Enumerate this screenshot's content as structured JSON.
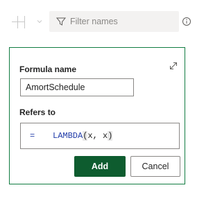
{
  "toolbar": {
    "add_icon": "add-icon",
    "chevron_icon": "chevron-down-icon",
    "filter_icon": "filter-icon",
    "filter_placeholder": "Filter names",
    "info_icon": "info-icon"
  },
  "dialog": {
    "expand_icon": "expand-icon",
    "name_label": "Formula name",
    "name_value": "AmortSchedule",
    "refers_label": "Refers to",
    "refers_equals": "=",
    "refers_function": "LAMBDA",
    "refers_open_paren": "(",
    "refers_args": "x, x",
    "refers_close_paren": ")",
    "add_label": "Add",
    "cancel_label": "Cancel"
  },
  "colors": {
    "accent": "#107c41",
    "primary_button": "#0e5c2f",
    "formula_blue": "#1f3aa8",
    "filter_bg": "#f3f2f1"
  }
}
